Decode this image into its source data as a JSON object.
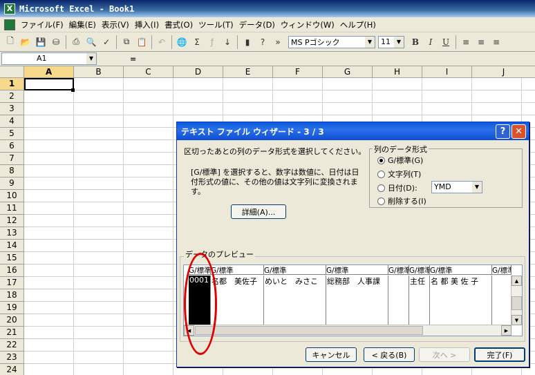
{
  "window": {
    "title": "Microsoft Excel - Book1"
  },
  "menu": [
    "ファイル(F)",
    "編集(E)",
    "表示(V)",
    "挿入(I)",
    "書式(O)",
    "ツール(T)",
    "データ(D)",
    "ウィンドウ(W)",
    "ヘルプ(H)"
  ],
  "toolbar": {
    "font_name": "MS Pゴシック",
    "font_size": "11",
    "bold": "B",
    "italic": "I",
    "underline": "U"
  },
  "formula_bar": {
    "name_box": "A1",
    "equals": "="
  },
  "sheet": {
    "columns": [
      "A",
      "B",
      "C",
      "D",
      "E",
      "F",
      "G",
      "H",
      "I",
      "J"
    ],
    "rows": [
      "1",
      "2",
      "3",
      "4",
      "5",
      "6",
      "7",
      "8",
      "9",
      "10",
      "11",
      "12",
      "13",
      "14",
      "15",
      "16",
      "17",
      "18",
      "19",
      "20",
      "21",
      "22",
      "23",
      "24"
    ],
    "active_cell": "A1"
  },
  "dialog": {
    "title": "テキスト ファイル ウィザード - 3 / 3",
    "instruction": "区切ったあとの列のデータ形式を選択してください。",
    "description_line1": "[G/標準] を選択すると、数字は数値に、日付は日",
    "description_line2": "付形式の値に、その他の値は文字列に変換されま",
    "description_line3": "す。",
    "advanced_button": "詳細(A)...",
    "column_format_group": "列のデータ形式",
    "radio_general": "G/標準(G)",
    "radio_text": "文字列(T)",
    "radio_date": "日付(D):",
    "radio_skip": "削除する(I)",
    "date_format": "YMD",
    "preview_label": "データのプレビュー",
    "preview_headers": [
      "G/標準",
      "G/標準",
      "G/標準",
      "G/標準",
      "G/標準",
      "G/標準",
      "G/標準",
      "G/標準"
    ],
    "preview_row": [
      "0001",
      "名都　美佐子",
      "めいと　みさこ",
      "総務部　人事課",
      "",
      "主任",
      "名 都 美 佐 子",
      ""
    ],
    "cancel_button": "キャンセル",
    "back_button": "< 戻る(B)",
    "next_button": "次へ >",
    "finish_button": "完了(F)"
  }
}
